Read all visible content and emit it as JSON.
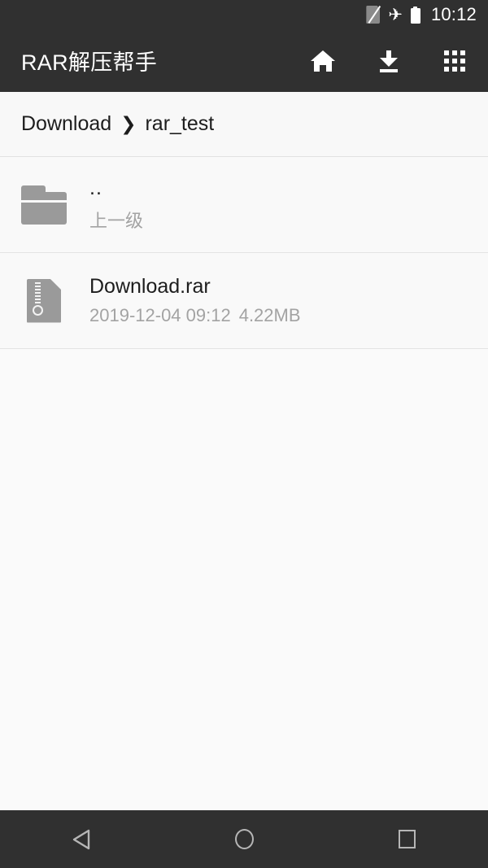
{
  "status_bar": {
    "time": "10:12",
    "icons": [
      "sim-off-icon",
      "airplane-mode-icon",
      "battery-icon"
    ]
  },
  "app_bar": {
    "title": "RAR解压帮手",
    "actions": [
      {
        "name": "home-icon",
        "label": "home"
      },
      {
        "name": "download-icon",
        "label": "download"
      },
      {
        "name": "apps-grid-icon",
        "label": "apps"
      }
    ]
  },
  "breadcrumb": {
    "root": "Download",
    "separator": "❯",
    "current": "rar_test"
  },
  "file_list": {
    "rows": [
      {
        "icon": "folder-icon",
        "title": "..",
        "subtitle": "上一级"
      },
      {
        "icon": "archive-icon",
        "title": "Download.rar",
        "date": "2019-12-04 09:12",
        "size": "4.22MB"
      }
    ]
  },
  "nav_bar": {
    "back": "back-icon",
    "home": "home-circle-icon",
    "recents": "recents-square-icon"
  },
  "colors": {
    "app_bar_bg": "#303030",
    "page_bg": "#fafafa",
    "breadcrumb_bg": "#f8f8f8",
    "primary_text": "#1d1d1d",
    "secondary_text": "#a3a3a3",
    "icon_gray": "#9a9a9a",
    "divider": "#e4e4e4",
    "nav_icon": "#b6b6b6"
  }
}
